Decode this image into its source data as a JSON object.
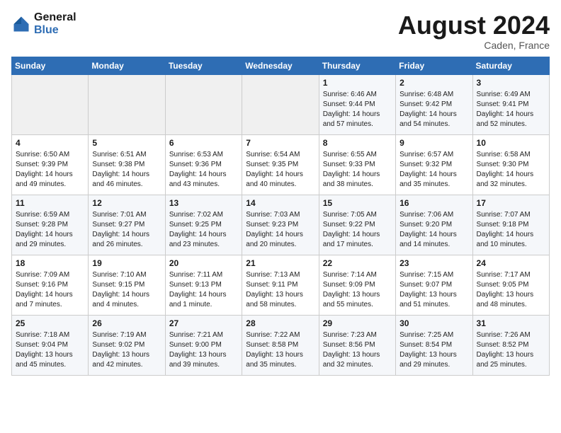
{
  "header": {
    "logo_line1": "General",
    "logo_line2": "Blue",
    "month_year": "August 2024",
    "location": "Caden, France"
  },
  "weekdays": [
    "Sunday",
    "Monday",
    "Tuesday",
    "Wednesday",
    "Thursday",
    "Friday",
    "Saturday"
  ],
  "weeks": [
    [
      {
        "date": "",
        "info": ""
      },
      {
        "date": "",
        "info": ""
      },
      {
        "date": "",
        "info": ""
      },
      {
        "date": "",
        "info": ""
      },
      {
        "date": "1",
        "info": "Sunrise: 6:46 AM\nSunset: 9:44 PM\nDaylight: 14 hours\nand 57 minutes."
      },
      {
        "date": "2",
        "info": "Sunrise: 6:48 AM\nSunset: 9:42 PM\nDaylight: 14 hours\nand 54 minutes."
      },
      {
        "date": "3",
        "info": "Sunrise: 6:49 AM\nSunset: 9:41 PM\nDaylight: 14 hours\nand 52 minutes."
      }
    ],
    [
      {
        "date": "4",
        "info": "Sunrise: 6:50 AM\nSunset: 9:39 PM\nDaylight: 14 hours\nand 49 minutes."
      },
      {
        "date": "5",
        "info": "Sunrise: 6:51 AM\nSunset: 9:38 PM\nDaylight: 14 hours\nand 46 minutes."
      },
      {
        "date": "6",
        "info": "Sunrise: 6:53 AM\nSunset: 9:36 PM\nDaylight: 14 hours\nand 43 minutes."
      },
      {
        "date": "7",
        "info": "Sunrise: 6:54 AM\nSunset: 9:35 PM\nDaylight: 14 hours\nand 40 minutes."
      },
      {
        "date": "8",
        "info": "Sunrise: 6:55 AM\nSunset: 9:33 PM\nDaylight: 14 hours\nand 38 minutes."
      },
      {
        "date": "9",
        "info": "Sunrise: 6:57 AM\nSunset: 9:32 PM\nDaylight: 14 hours\nand 35 minutes."
      },
      {
        "date": "10",
        "info": "Sunrise: 6:58 AM\nSunset: 9:30 PM\nDaylight: 14 hours\nand 32 minutes."
      }
    ],
    [
      {
        "date": "11",
        "info": "Sunrise: 6:59 AM\nSunset: 9:28 PM\nDaylight: 14 hours\nand 29 minutes."
      },
      {
        "date": "12",
        "info": "Sunrise: 7:01 AM\nSunset: 9:27 PM\nDaylight: 14 hours\nand 26 minutes."
      },
      {
        "date": "13",
        "info": "Sunrise: 7:02 AM\nSunset: 9:25 PM\nDaylight: 14 hours\nand 23 minutes."
      },
      {
        "date": "14",
        "info": "Sunrise: 7:03 AM\nSunset: 9:23 PM\nDaylight: 14 hours\nand 20 minutes."
      },
      {
        "date": "15",
        "info": "Sunrise: 7:05 AM\nSunset: 9:22 PM\nDaylight: 14 hours\nand 17 minutes."
      },
      {
        "date": "16",
        "info": "Sunrise: 7:06 AM\nSunset: 9:20 PM\nDaylight: 14 hours\nand 14 minutes."
      },
      {
        "date": "17",
        "info": "Sunrise: 7:07 AM\nSunset: 9:18 PM\nDaylight: 14 hours\nand 10 minutes."
      }
    ],
    [
      {
        "date": "18",
        "info": "Sunrise: 7:09 AM\nSunset: 9:16 PM\nDaylight: 14 hours\nand 7 minutes."
      },
      {
        "date": "19",
        "info": "Sunrise: 7:10 AM\nSunset: 9:15 PM\nDaylight: 14 hours\nand 4 minutes."
      },
      {
        "date": "20",
        "info": "Sunrise: 7:11 AM\nSunset: 9:13 PM\nDaylight: 14 hours\nand 1 minute."
      },
      {
        "date": "21",
        "info": "Sunrise: 7:13 AM\nSunset: 9:11 PM\nDaylight: 13 hours\nand 58 minutes."
      },
      {
        "date": "22",
        "info": "Sunrise: 7:14 AM\nSunset: 9:09 PM\nDaylight: 13 hours\nand 55 minutes."
      },
      {
        "date": "23",
        "info": "Sunrise: 7:15 AM\nSunset: 9:07 PM\nDaylight: 13 hours\nand 51 minutes."
      },
      {
        "date": "24",
        "info": "Sunrise: 7:17 AM\nSunset: 9:05 PM\nDaylight: 13 hours\nand 48 minutes."
      }
    ],
    [
      {
        "date": "25",
        "info": "Sunrise: 7:18 AM\nSunset: 9:04 PM\nDaylight: 13 hours\nand 45 minutes."
      },
      {
        "date": "26",
        "info": "Sunrise: 7:19 AM\nSunset: 9:02 PM\nDaylight: 13 hours\nand 42 minutes."
      },
      {
        "date": "27",
        "info": "Sunrise: 7:21 AM\nSunset: 9:00 PM\nDaylight: 13 hours\nand 39 minutes."
      },
      {
        "date": "28",
        "info": "Sunrise: 7:22 AM\nSunset: 8:58 PM\nDaylight: 13 hours\nand 35 minutes."
      },
      {
        "date": "29",
        "info": "Sunrise: 7:23 AM\nSunset: 8:56 PM\nDaylight: 13 hours\nand 32 minutes."
      },
      {
        "date": "30",
        "info": "Sunrise: 7:25 AM\nSunset: 8:54 PM\nDaylight: 13 hours\nand 29 minutes."
      },
      {
        "date": "31",
        "info": "Sunrise: 7:26 AM\nSunset: 8:52 PM\nDaylight: 13 hours\nand 25 minutes."
      }
    ]
  ]
}
